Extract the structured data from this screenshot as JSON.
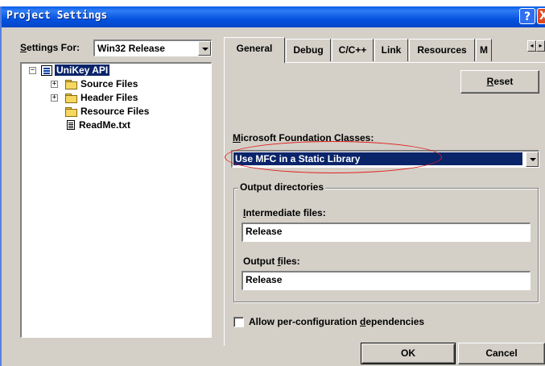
{
  "window": {
    "title": "Project Settings",
    "help_glyph": "?",
    "close_glyph": "X"
  },
  "left": {
    "settings_for_accel": "S",
    "settings_for_rest": "ettings For:",
    "configuration": "Win32 Release",
    "tree": {
      "root": "UniKey API",
      "items": [
        {
          "label": "Source Files",
          "expandable": true
        },
        {
          "label": "Header Files",
          "expandable": true
        },
        {
          "label": "Resource Files",
          "expandable": false
        },
        {
          "label": "ReadMe.txt",
          "type": "file"
        }
      ]
    }
  },
  "tabs": {
    "labels": [
      "General",
      "Debug",
      "C/C++",
      "Link",
      "Resources",
      "M"
    ],
    "active": "General",
    "scroll_left": "◂",
    "scroll_right": "▸"
  },
  "general": {
    "reset_accel": "R",
    "reset_rest": "eset",
    "mfc_label_accel": "M",
    "mfc_label_rest": "icrosoft Foundation Classes:",
    "mfc_value": "Use MFC in a Static Library",
    "output_group": "Output directories",
    "intermediate_label_accel": "I",
    "intermediate_label_rest": "ntermediate files:",
    "intermediate_value": "Release",
    "output_label_pre": "Output ",
    "output_label_accel": "f",
    "output_label_post": "iles:",
    "output_value": "Release",
    "allow_pre": "Allow per-configuration ",
    "allow_accel": "d",
    "allow_post": "ependencies"
  },
  "buttons": {
    "ok": "OK",
    "cancel": "Cancel"
  },
  "colors": {
    "titlebar": "#0553e0",
    "selection": "#0a246a",
    "annotation": "#e02020",
    "face": "#d4d0c8"
  }
}
